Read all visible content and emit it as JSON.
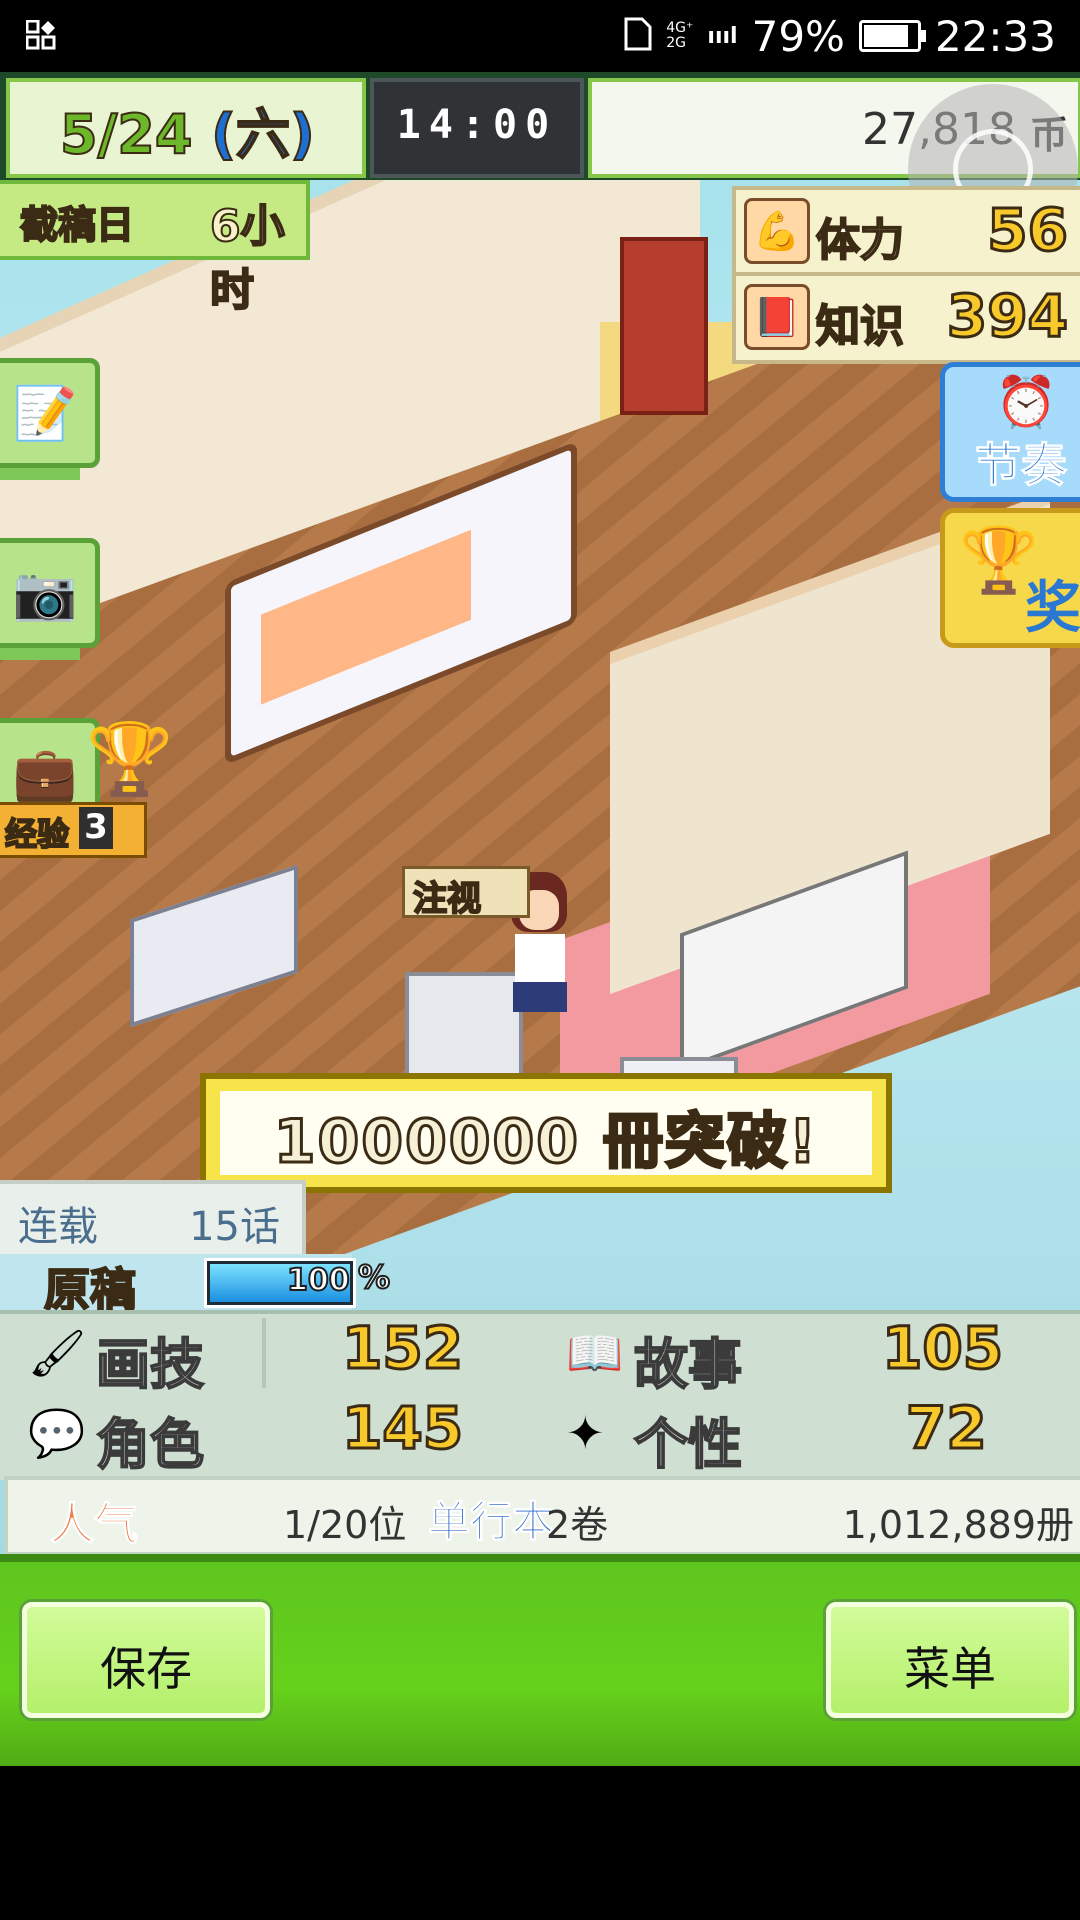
{
  "status_bar": {
    "network": "4G⁺\n2G",
    "signal": "ıııl",
    "battery_percent": "79%",
    "battery_level": 0.79,
    "time": "22:33"
  },
  "header": {
    "month": "5",
    "date_rest": "/24",
    "weekday": "(六)",
    "clock": "14:00",
    "money": "27,818",
    "money_unit": "币"
  },
  "deadline": {
    "label": "截稿日",
    "value": "6小时"
  },
  "stats": {
    "stamina": {
      "label": "体力",
      "value": "56"
    },
    "knowledge": {
      "label": "知识",
      "value": "394"
    }
  },
  "side_buttons": {
    "rhythm": "节奏",
    "award": "奖",
    "experience_label": "经验",
    "experience_value": "3"
  },
  "scene": {
    "attention_label": "注视"
  },
  "banner": {
    "text": "1000000 冊突破!"
  },
  "serial": {
    "label": "连载",
    "episodes": "15话"
  },
  "manuscript": {
    "label": "原稿",
    "progress_text": "100",
    "progress_unit": "%",
    "progress": 1.0
  },
  "panel": {
    "drawing": {
      "label": "画技",
      "value": "152"
    },
    "story": {
      "label": "故事",
      "value": "105"
    },
    "character": {
      "label": "角色",
      "value": "145"
    },
    "personality": {
      "label": "个性",
      "value": "72"
    }
  },
  "popularity": {
    "label": "人气",
    "rank": "1/20位",
    "volumes_label": "单行本",
    "volumes": "2卷",
    "sales": "1,012,889册"
  },
  "bottom": {
    "save_label": "保存",
    "menu_label": "菜单"
  },
  "colors": {
    "accent_green": "#66d11c",
    "gold": "#f8c92b",
    "sky": "#a3e1ea"
  }
}
